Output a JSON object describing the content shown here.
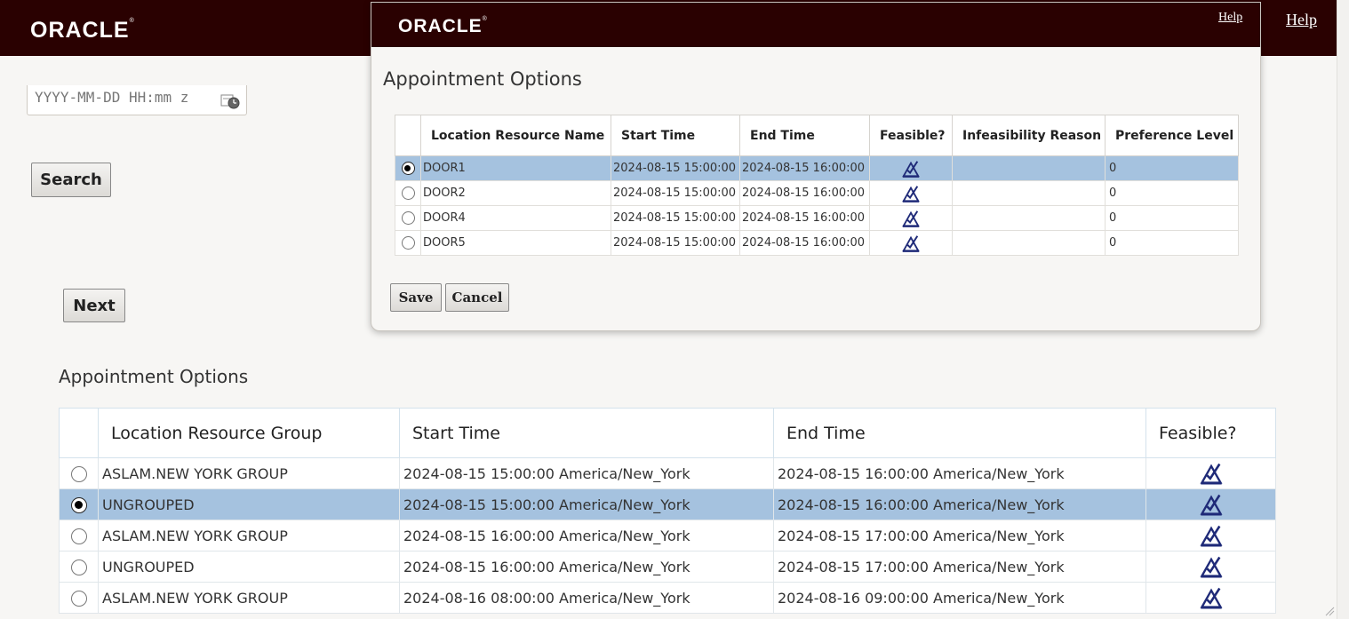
{
  "header": {
    "logo": "ORACLE",
    "help": "Help"
  },
  "search": {
    "date_placeholder": "YYYY-MM-DD HH:mm z",
    "search_label": "Search",
    "next_label": "Next"
  },
  "main": {
    "title": "Appointment Options",
    "columns": [
      "Location Resource Group",
      "Start Time",
      "End Time",
      "Feasible?"
    ],
    "rows": [
      {
        "group": "ASLAM.NEW YORK GROUP",
        "start": "2024-08-15 15:00:00 America/New_York",
        "end": "2024-08-15 16:00:00 America/New_York",
        "selected": false
      },
      {
        "group": "UNGROUPED",
        "start": "2024-08-15 15:00:00 America/New_York",
        "end": "2024-08-15 16:00:00 America/New_York",
        "selected": true
      },
      {
        "group": "ASLAM.NEW YORK GROUP",
        "start": "2024-08-15 16:00:00 America/New_York",
        "end": "2024-08-15 17:00:00 America/New_York",
        "selected": false
      },
      {
        "group": "UNGROUPED",
        "start": "2024-08-15 16:00:00 America/New_York",
        "end": "2024-08-15 17:00:00 America/New_York",
        "selected": false
      },
      {
        "group": "ASLAM.NEW YORK GROUP",
        "start": "2024-08-16 08:00:00 America/New_York",
        "end": "2024-08-16 09:00:00 America/New_York",
        "selected": false
      }
    ]
  },
  "dialog": {
    "logo": "ORACLE",
    "help": "Help",
    "title": "Appointment Options",
    "columns": [
      "Location Resource Name",
      "Start Time",
      "End Time",
      "Feasible?",
      "Infeasibility Reason",
      "Preference Level"
    ],
    "rows": [
      {
        "name": "DOOR1",
        "start": "2024-08-15 15:00:00",
        "end": "2024-08-15 16:00:00",
        "reason": "",
        "pref": "0",
        "selected": true
      },
      {
        "name": "DOOR2",
        "start": "2024-08-15 15:00:00",
        "end": "2024-08-15 16:00:00",
        "reason": "",
        "pref": "0",
        "selected": false
      },
      {
        "name": "DOOR4",
        "start": "2024-08-15 15:00:00",
        "end": "2024-08-15 16:00:00",
        "reason": "",
        "pref": "0",
        "selected": false
      },
      {
        "name": "DOOR5",
        "start": "2024-08-15 15:00:00",
        "end": "2024-08-15 16:00:00",
        "reason": "",
        "pref": "0",
        "selected": false
      }
    ],
    "save_label": "Save",
    "cancel_label": "Cancel"
  },
  "icons": {
    "feasible": "feasible-check-icon",
    "calendar": "calendar-clock-icon"
  },
  "colors": {
    "header_bg": "#2a0101",
    "selected_row": "#a5c2df",
    "icon_blue": "#1f2a78"
  }
}
